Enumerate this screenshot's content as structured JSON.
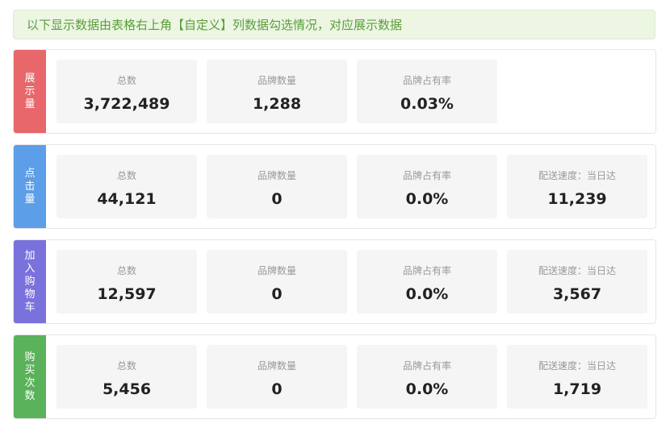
{
  "banner": {
    "text": "以下显示数据由表格右上角【自定义】列数据勾选情况，对应展示数据"
  },
  "groups": [
    {
      "label": [
        "展",
        "示",
        "量"
      ],
      "color": "#e8676b",
      "cards": [
        {
          "label": "总数",
          "value": "3,722,489"
        },
        {
          "label": "品牌数量",
          "value": "1,288"
        },
        {
          "label": "品牌占有率",
          "value": "0.03%"
        }
      ]
    },
    {
      "label": [
        "点",
        "击",
        "量"
      ],
      "color": "#5c9ee8",
      "cards": [
        {
          "label": "总数",
          "value": "44,121"
        },
        {
          "label": "品牌数量",
          "value": "0"
        },
        {
          "label": "品牌占有率",
          "value": "0.0%"
        },
        {
          "label": "配送速度：当日达",
          "value": "11,239"
        }
      ]
    },
    {
      "label": [
        "加",
        "入",
        "购",
        "物",
        "车"
      ],
      "color": "#7a72dc",
      "cards": [
        {
          "label": "总数",
          "value": "12,597"
        },
        {
          "label": "品牌数量",
          "value": "0"
        },
        {
          "label": "品牌占有率",
          "value": "0.0%"
        },
        {
          "label": "配送速度：当日达",
          "value": "3,567"
        }
      ]
    },
    {
      "label": [
        "购",
        "买",
        "次",
        "数"
      ],
      "color": "#5ab25a",
      "cards": [
        {
          "label": "总数",
          "value": "5,456"
        },
        {
          "label": "品牌数量",
          "value": "0"
        },
        {
          "label": "品牌占有率",
          "value": "0.0%"
        },
        {
          "label": "配送速度：当日达",
          "value": "1,719"
        }
      ]
    }
  ]
}
